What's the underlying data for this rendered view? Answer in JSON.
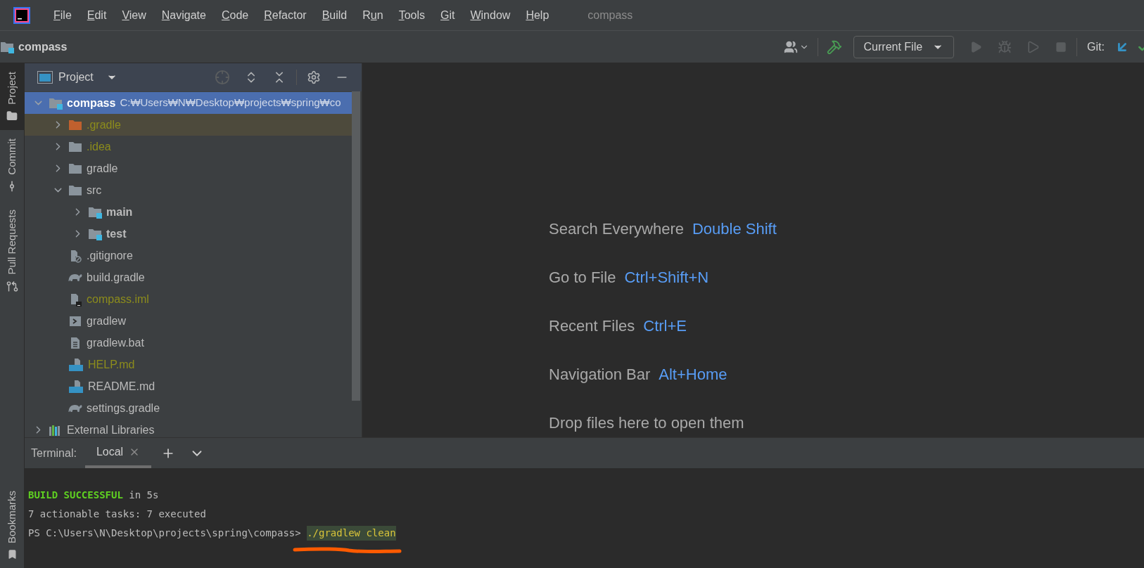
{
  "menu": [
    {
      "key": "F",
      "post": "ile"
    },
    {
      "key": "E",
      "post": "dit"
    },
    {
      "key": "V",
      "post": "iew"
    },
    {
      "key": "N",
      "post": "avigate"
    },
    {
      "key": "C",
      "post": "ode"
    },
    {
      "key": "R",
      "post": "efactor"
    },
    {
      "key": "B",
      "post": "uild"
    },
    {
      "pre": "R",
      "key": "u",
      "post": "n"
    },
    {
      "key": "T",
      "post": "ools"
    },
    {
      "key": "G",
      "post": "it"
    },
    {
      "key": "W",
      "post": "indow"
    },
    {
      "key": "H",
      "post": "elp"
    }
  ],
  "window": {
    "title": "compass"
  },
  "toolbar": {
    "breadcrumb": "compass",
    "run_config": "Current File",
    "git_label": "Git:"
  },
  "side_tabs": [
    {
      "label": "Project",
      "selected": true,
      "kind": "project"
    },
    {
      "label": "Commit",
      "selected": false,
      "kind": "commit"
    },
    {
      "label": "Pull Requests",
      "selected": false,
      "kind": "pull"
    }
  ],
  "bottom_side_tabs": [
    {
      "label": "Bookmarks",
      "selected": false,
      "kind": "bookmarks"
    }
  ],
  "project_panel": {
    "title": "Project",
    "tree": [
      {
        "name": "compass",
        "path": "C:₩Users₩N₩Desktop₩projects₩spring₩co",
        "kind": "module",
        "expanded": true,
        "selected": true,
        "highlighted": false,
        "ignored": false,
        "children": [
          {
            "name": ".gradle",
            "kind": "excluded_folder",
            "expanded": false,
            "selected": false,
            "highlighted": true,
            "ignored": true
          },
          {
            "name": ".idea",
            "kind": "folder",
            "expanded": false,
            "selected": false,
            "highlighted": false,
            "ignored": true
          },
          {
            "name": "gradle",
            "kind": "folder",
            "expanded": false,
            "selected": false,
            "highlighted": false,
            "ignored": false
          },
          {
            "name": "src",
            "kind": "folder",
            "expanded": true,
            "selected": false,
            "highlighted": false,
            "ignored": false,
            "children": [
              {
                "name": "main",
                "kind": "source_folder",
                "expanded": false,
                "selected": false,
                "highlighted": false,
                "ignored": false
              },
              {
                "name": "test",
                "kind": "source_folder",
                "expanded": false,
                "selected": false,
                "highlighted": false,
                "ignored": false
              }
            ]
          },
          {
            "name": ".gitignore",
            "kind": "gitignore",
            "selected": false,
            "highlighted": false,
            "ignored": false
          },
          {
            "name": "build.gradle",
            "kind": "gradle",
            "selected": false,
            "highlighted": false,
            "ignored": false
          },
          {
            "name": "compass.iml",
            "kind": "iml",
            "selected": false,
            "highlighted": false,
            "ignored": true
          },
          {
            "name": "gradlew",
            "kind": "script",
            "selected": false,
            "highlighted": false,
            "ignored": false
          },
          {
            "name": "gradlew.bat",
            "kind": "text",
            "selected": false,
            "highlighted": false,
            "ignored": false
          },
          {
            "name": "HELP.md",
            "kind": "markdown",
            "selected": false,
            "highlighted": false,
            "ignored": true
          },
          {
            "name": "README.md",
            "kind": "markdown",
            "selected": false,
            "highlighted": false,
            "ignored": false
          },
          {
            "name": "settings.gradle",
            "kind": "gradle",
            "selected": false,
            "highlighted": false,
            "ignored": false
          }
        ]
      },
      {
        "name": "External Libraries",
        "kind": "libraries",
        "expanded": false,
        "selected": false,
        "highlighted": false,
        "ignored": false
      }
    ]
  },
  "welcome": [
    {
      "label": "Search Everywhere",
      "shortcut": "Double Shift"
    },
    {
      "label": "Go to File",
      "shortcut": "Ctrl+Shift+N"
    },
    {
      "label": "Recent Files",
      "shortcut": "Ctrl+E"
    },
    {
      "label": "Navigation Bar",
      "shortcut": "Alt+Home"
    },
    {
      "label": "Drop files here to open them"
    }
  ],
  "terminal": {
    "title": "Terminal:",
    "tabs": [
      {
        "label": "Local",
        "selected": true
      }
    ],
    "lines": [
      [
        {
          "text": "BUILD SUCCESSFUL",
          "kind": "success"
        },
        {
          "text": " in 5s",
          "kind": "plain"
        }
      ],
      [
        {
          "text": "7 actionable tasks: 7 executed",
          "kind": "plain"
        }
      ],
      [
        {
          "text": "PS C:\\Users\\N\\Desktop\\projects\\spring\\compass> ",
          "kind": "plain"
        },
        {
          "text": "./gradlew clean",
          "kind": "command"
        }
      ]
    ]
  }
}
